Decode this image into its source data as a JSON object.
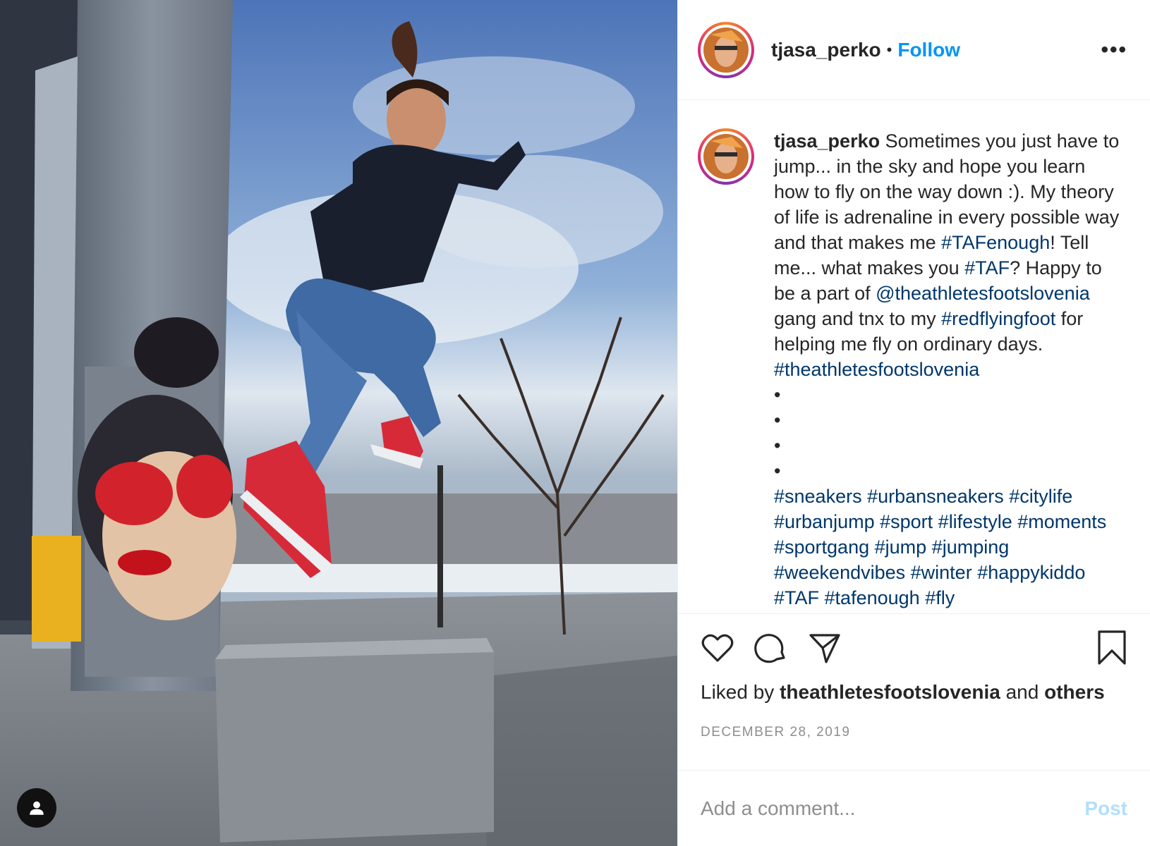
{
  "post": {
    "username": "tjasa_perko",
    "separator": "•",
    "follow_label": "Follow",
    "more_icon": "•••"
  },
  "caption": {
    "username": "tjasa_perko",
    "t1": " Sometimes you just have to jump... in the sky and hope you learn how to fly on the way down :). My theory of life is adrenaline in every possible way and that makes me ",
    "tag_tafenough": "#TAFenough",
    "t2": "! Tell me... what makes you ",
    "tag_taf": "#TAF",
    "t3": "? Happy to be a part of ",
    "mention": "@theathletesfootslovenia",
    "t4": " gang and tnx to my ",
    "tag_redflyingfoot": "#redflyingfoot",
    "t5": " for helping me fly on ordinary days.",
    "tag_theathletes": "#theathletesfootslovenia",
    "bullets": [
      "•",
      "•",
      "•",
      "•"
    ],
    "hashtags": [
      "#sneakers",
      "#urbansneakers",
      "#citylife",
      "#urbanjump",
      "#sport",
      "#lifestyle",
      "#moments",
      "#sportgang",
      "#jump",
      "#jumping",
      "#weekendvibes",
      "#winter",
      "#happykiddo",
      "#TAF",
      "#tafenough",
      "#fly"
    ]
  },
  "likes": {
    "prefix": "Liked by ",
    "user": "theathletesfootslovenia",
    "middle": " and ",
    "others": "others"
  },
  "date": "DECEMBER 28, 2019",
  "comment": {
    "placeholder": "Add a comment...",
    "post_label": "Post"
  },
  "icons": [
    "heart-icon",
    "comment-icon",
    "share-icon",
    "bookmark-icon",
    "user-tag-icon"
  ],
  "colors": {
    "follow": "#0095f6",
    "link": "#00376b",
    "muted": "#8e8e8e",
    "post_disabled": "#b2dffc"
  }
}
